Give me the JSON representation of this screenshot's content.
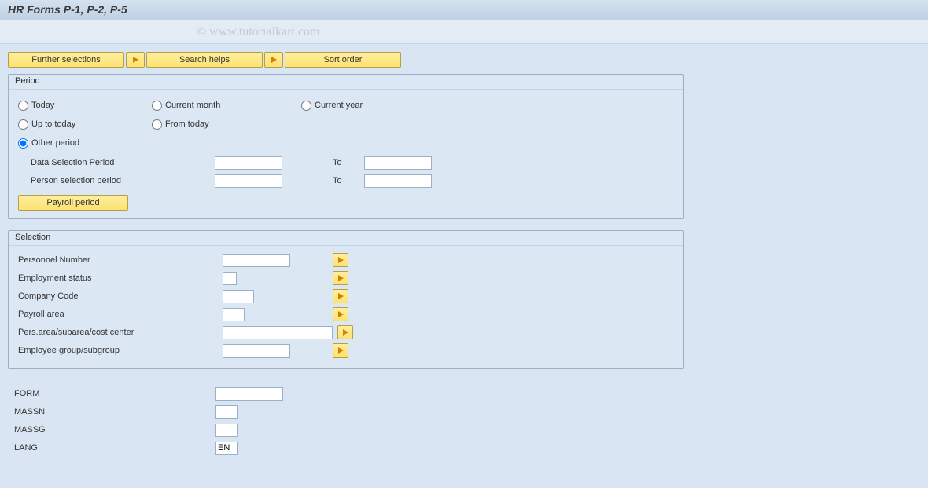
{
  "title": "HR Forms P-1, P-2, P-5",
  "watermark": "© www.tutorialkart.com",
  "buttons": {
    "further_selections": "Further selections",
    "search_helps": "Search helps",
    "sort_order": "Sort order",
    "payroll_period": "Payroll period"
  },
  "panels": {
    "period": "Period",
    "selection": "Selection"
  },
  "period": {
    "radios": {
      "today": "Today",
      "current_month": "Current month",
      "current_year": "Current year",
      "up_to_today": "Up to today",
      "from_today": "From today",
      "other_period": "Other period"
    },
    "data_selection_period": "Data Selection Period",
    "person_selection_period": "Person selection period",
    "to": "To",
    "data_from": "",
    "data_to": "",
    "person_from": "",
    "person_to": ""
  },
  "selection": {
    "personnel_number": {
      "label": "Personnel Number",
      "value": ""
    },
    "employment_status": {
      "label": "Employment status",
      "value": ""
    },
    "company_code": {
      "label": "Company Code",
      "value": ""
    },
    "payroll_area": {
      "label": "Payroll area",
      "value": ""
    },
    "pers_area": {
      "label": "Pers.area/subarea/cost center",
      "value": ""
    },
    "employee_group": {
      "label": "Employee group/subgroup",
      "value": ""
    }
  },
  "bottom": {
    "form": {
      "label": "FORM",
      "value": ""
    },
    "massn": {
      "label": "MASSN",
      "value": ""
    },
    "massg": {
      "label": "MASSG",
      "value": ""
    },
    "lang": {
      "label": "LANG",
      "value": "EN"
    }
  }
}
